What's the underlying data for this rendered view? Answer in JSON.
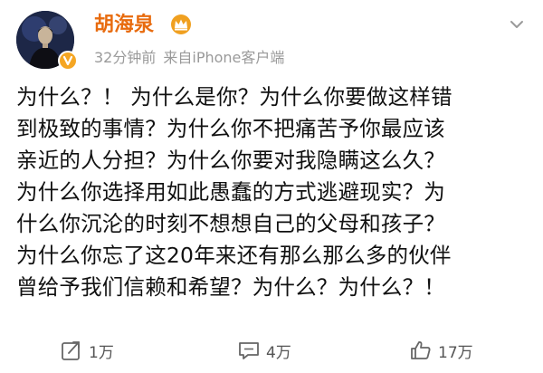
{
  "user": {
    "name": "胡海泉",
    "time": "32分钟前",
    "source": "来自iPhone客户端",
    "avatar": "avatar-photo",
    "badge": "verified-v-badge",
    "crown": "crown-icon"
  },
  "post": {
    "lines": [
      "为什么？！ 为什么是你？为什么你要做这样错",
      "到极致的事情？为什么你不把痛苦予你最应该",
      "亲近的人分担？为什么你要对我隐瞒这么久？",
      "为什么你选择用如此愚蠢的方式逃避现实？为",
      "什么你沉沦的时刻不想想自己的父母和孩子？",
      "为什么你忘了这20年来还有那么那么多的伙伴",
      "曾给予我们信赖和希望？为什么？为什么？！"
    ]
  },
  "actions": {
    "repost": {
      "count": "1万",
      "icon": "repost-icon"
    },
    "comment": {
      "count": "4万",
      "icon": "comment-icon"
    },
    "like": {
      "count": "17万",
      "icon": "like-icon"
    }
  },
  "colors": {
    "username": "#e86b0e",
    "meta": "#9a9a9a",
    "badge": "#f5a623"
  }
}
